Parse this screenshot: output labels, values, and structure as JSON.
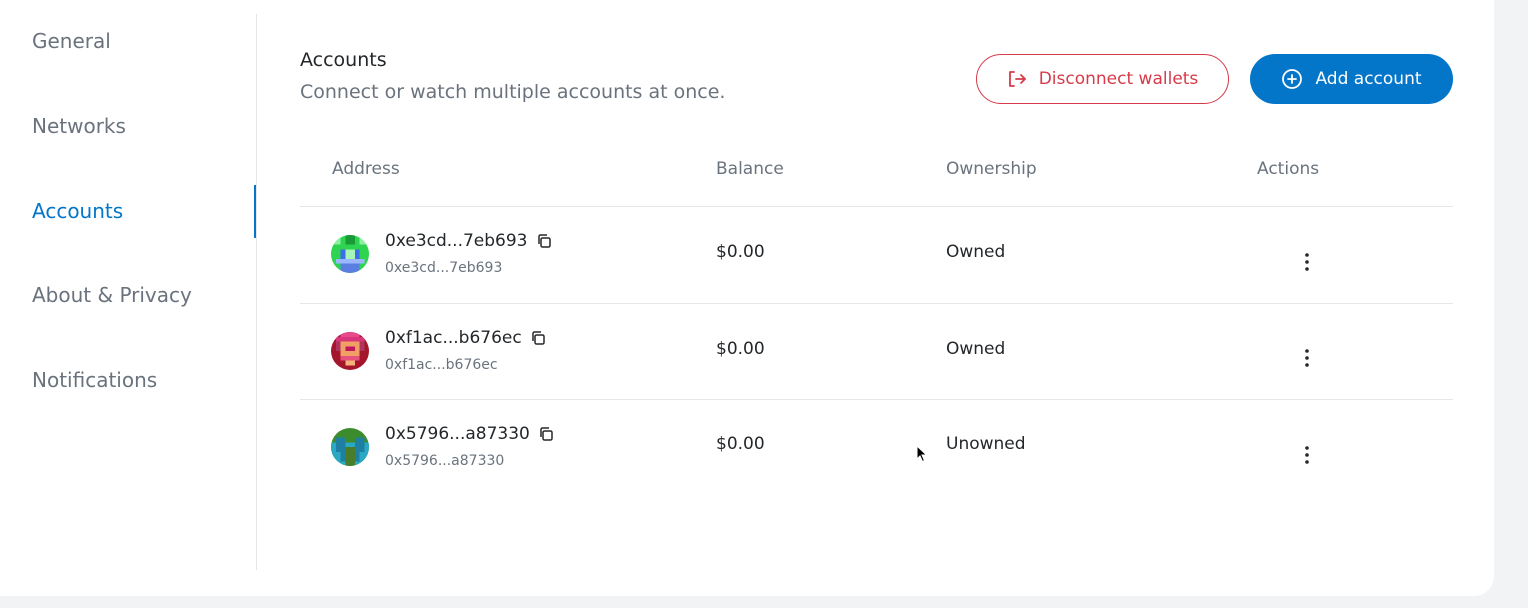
{
  "sidebar": {
    "items": [
      {
        "label": "General",
        "active": false
      },
      {
        "label": "Networks",
        "active": false
      },
      {
        "label": "Accounts",
        "active": true
      },
      {
        "label": "About & Privacy",
        "active": false
      },
      {
        "label": "Notifications",
        "active": false
      }
    ]
  },
  "accounts": {
    "title": "Accounts",
    "subtitle": "Connect or watch multiple accounts at once.",
    "disconnect_label": "Disconnect wallets",
    "add_label": "Add account",
    "disconnect_icon": "logout-icon",
    "add_icon": "plus-circle-icon"
  },
  "table": {
    "columns": [
      "Address",
      "Balance",
      "Ownership",
      "Actions"
    ],
    "rows": [
      {
        "address": "0xe3cd...7eb693",
        "address_sub": "0xe3cd...7eb693",
        "balance": "$0.00",
        "ownership": "Owned"
      },
      {
        "address": "0xf1ac...b676ec",
        "address_sub": "0xf1ac...b676ec",
        "balance": "$0.00",
        "ownership": "Owned"
      },
      {
        "address": "0x5796...a87330",
        "address_sub": "0x5796...a87330",
        "balance": "$0.00",
        "ownership": "Unowned"
      }
    ]
  },
  "colors": {
    "accent": "#0376c9",
    "danger": "#d73a49",
    "muted": "#6a737d"
  }
}
